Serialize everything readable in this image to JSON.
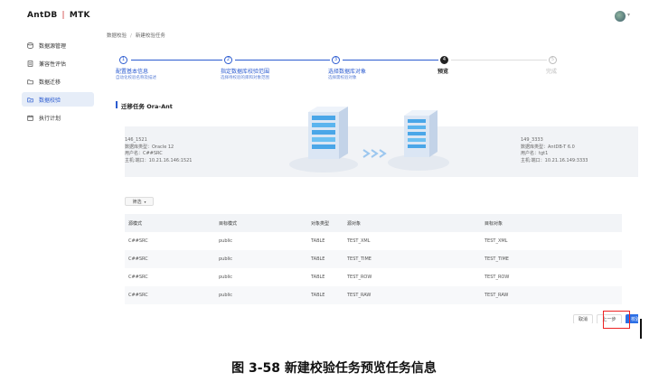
{
  "app": {
    "logo_left": "AntDB",
    "logo_right": "MTK"
  },
  "sidebar": {
    "items": [
      {
        "label": "数据源管理",
        "icon": "database-icon"
      },
      {
        "label": "兼容性评估",
        "icon": "report-icon"
      },
      {
        "label": "数据迁移",
        "icon": "folder-icon"
      },
      {
        "label": "数据校验",
        "icon": "folder-check-icon"
      },
      {
        "label": "执行计划",
        "icon": "calendar-icon"
      }
    ],
    "active_index": 3
  },
  "breadcrumb": {
    "parent": "数据校验",
    "current": "新建校验任务"
  },
  "steps": [
    {
      "num": "1",
      "title": "配置基本信息",
      "desc": "自动化校验名称及描述"
    },
    {
      "num": "2",
      "title": "指定数据库校验范围",
      "desc": "选择待校验的库和对象范围"
    },
    {
      "num": "3",
      "title": "选择数据库对象",
      "desc": "选择需校验对象"
    },
    {
      "num": "4",
      "title": "预览",
      "desc": ""
    },
    {
      "num": "5",
      "title": "完成",
      "desc": ""
    }
  ],
  "section": {
    "title": "迁移任务 Ora-Ant"
  },
  "source": {
    "name": "146_1521",
    "db_type": "数据库类型：Oracle 12",
    "user": "用户名：C##SRC",
    "host": "主机:端口：10.21.16.146:1521"
  },
  "target": {
    "name": "149_3333",
    "db_type": "数据库类型：AntDB-T 6.0",
    "user": "用户名：tgt1",
    "host": "主机:端口：10.21.16.149:3333"
  },
  "filter": {
    "label": "筛选"
  },
  "table": {
    "headers": [
      "源模式",
      "目标模式",
      "对象类型",
      "源对象",
      "目标对象"
    ],
    "rows": [
      [
        "C##SRC",
        "public",
        "TABLE",
        "TEST_XML",
        "TEST_XML"
      ],
      [
        "C##SRC",
        "public",
        "TABLE",
        "TEST_TIME",
        "TEST_TIME"
      ],
      [
        "C##SRC",
        "public",
        "TABLE",
        "TEST_ROW",
        "TEST_ROW"
      ],
      [
        "C##SRC",
        "public",
        "TABLE",
        "TEST_RAW",
        "TEST_RAW"
      ]
    ]
  },
  "footer": {
    "cancel": "取消",
    "prev": "上一步",
    "submit": "校验"
  },
  "caption": "图 3-58  新建校验任务预览任务信息",
  "colors": {
    "accent": "#2b5bd0",
    "primary_button": "#2b6fe6",
    "highlight": "#e22222"
  }
}
